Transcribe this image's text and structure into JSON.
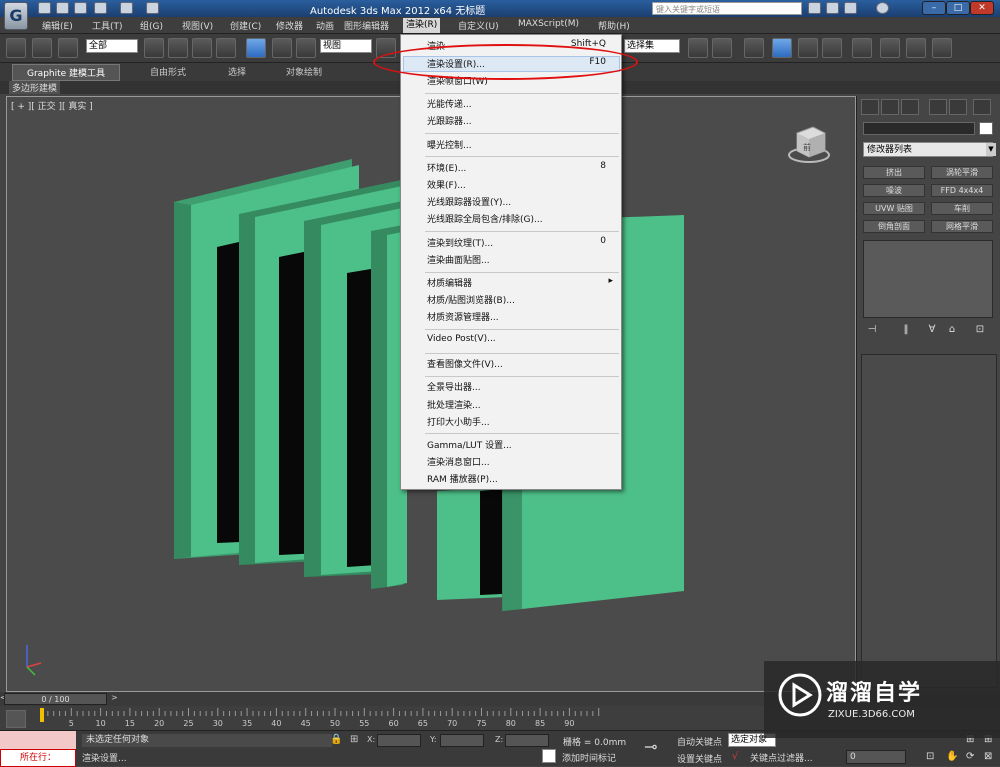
{
  "titlebar": {
    "title": "Autodesk 3ds Max  2012 x64      无标题",
    "search_placeholder": "键入关键字或短语"
  },
  "menubar": {
    "items": [
      "编辑(E)",
      "工具(T)",
      "组(G)",
      "视图(V)",
      "创建(C)",
      "修改器",
      "动画",
      "图形编辑器",
      "渲染(R)",
      "自定义(U)",
      "MAXScript(M)",
      "帮助(H)"
    ],
    "active": "渲染(R)"
  },
  "toolbar": {
    "selection_filter": "全部",
    "ref_coord": "视图",
    "named_sets": "选择集"
  },
  "ribbon": {
    "tabs": [
      "Graphite 建模工具",
      "自由形式",
      "选择",
      "对象绘制"
    ],
    "sub_tab": "多边形建模"
  },
  "viewport": {
    "label": "[ + ][ 正交 ][ 真实 ]",
    "viewcube_text": "前"
  },
  "render_menu": {
    "groups": [
      [
        {
          "label": "渲染",
          "shortcut": "Shift+Q"
        },
        {
          "label": "渲染设置(R)...",
          "shortcut": "F10"
        },
        {
          "label": "渲染帧窗口(W)",
          "shortcut": ""
        }
      ],
      [
        {
          "label": "光能传递...",
          "shortcut": ""
        },
        {
          "label": "光跟踪器...",
          "shortcut": ""
        }
      ],
      [
        {
          "label": "曝光控制...",
          "shortcut": ""
        }
      ],
      [
        {
          "label": "环境(E)...",
          "shortcut": "8"
        },
        {
          "label": "效果(F)...",
          "shortcut": ""
        },
        {
          "label": "光线跟踪器设置(Y)...",
          "shortcut": ""
        },
        {
          "label": "光线跟踪全局包含/排除(G)...",
          "shortcut": ""
        }
      ],
      [
        {
          "label": "渲染到纹理(T)...",
          "shortcut": "0"
        },
        {
          "label": "渲染曲面贴图...",
          "shortcut": ""
        }
      ],
      [
        {
          "label": "材质编辑器",
          "shortcut": "▸"
        },
        {
          "label": "材质/贴图浏览器(B)...",
          "shortcut": ""
        },
        {
          "label": "材质资源管理器...",
          "shortcut": ""
        }
      ],
      [
        {
          "label": "Video Post(V)...",
          "shortcut": ""
        }
      ],
      [
        {
          "label": "查看图像文件(V)...",
          "shortcut": ""
        }
      ],
      [
        {
          "label": "全景导出器...",
          "shortcut": ""
        },
        {
          "label": "批处理渲染...",
          "shortcut": ""
        },
        {
          "label": "打印大小助手...",
          "shortcut": ""
        }
      ],
      [
        {
          "label": "Gamma/LUT 设置...",
          "shortcut": ""
        },
        {
          "label": "渲染消息窗口...",
          "shortcut": ""
        },
        {
          "label": "RAM 播放器(P)...",
          "shortcut": ""
        }
      ]
    ],
    "highlighted": "渲染设置(R)..."
  },
  "command_panel": {
    "modifier_list": "修改器列表",
    "buttons": [
      "挤出",
      "涡轮平滑",
      "噪波",
      "FFD 4x4x4",
      "UVW 贴图",
      "车削",
      "倒角剖面",
      "网格平滑"
    ]
  },
  "timeline": {
    "frame_counter": "0 / 100",
    "left_arrow": "<",
    "right_arrow": ">",
    "ticks": [
      0,
      5,
      10,
      15,
      20,
      25,
      30,
      35,
      40,
      45,
      50,
      55,
      60,
      65,
      70,
      75,
      80,
      85,
      90
    ],
    "range": [
      0,
      100
    ]
  },
  "statusbar": {
    "listener": "",
    "listener_label": "所在行：",
    "status": "未选定任何对象",
    "prompt": "渲染设置...",
    "x_label": "X:",
    "y_label": "Y:",
    "z_label": "Z:",
    "grid": "栅格 = 0.0mm",
    "time_tag": "添加时间标记",
    "auto_key": "自动关键点",
    "set_key": "设置关键点",
    "selection": "选定对象",
    "key_filters": "关键点过滤器...",
    "frame": "0"
  },
  "watermark": {
    "name": "溜溜自学",
    "url": "ZIXUE.3D66.COM"
  },
  "colors": {
    "object_green": "#4dbf88",
    "highlight_red": "#e01010",
    "menu_bg": "#f2f2f2"
  }
}
